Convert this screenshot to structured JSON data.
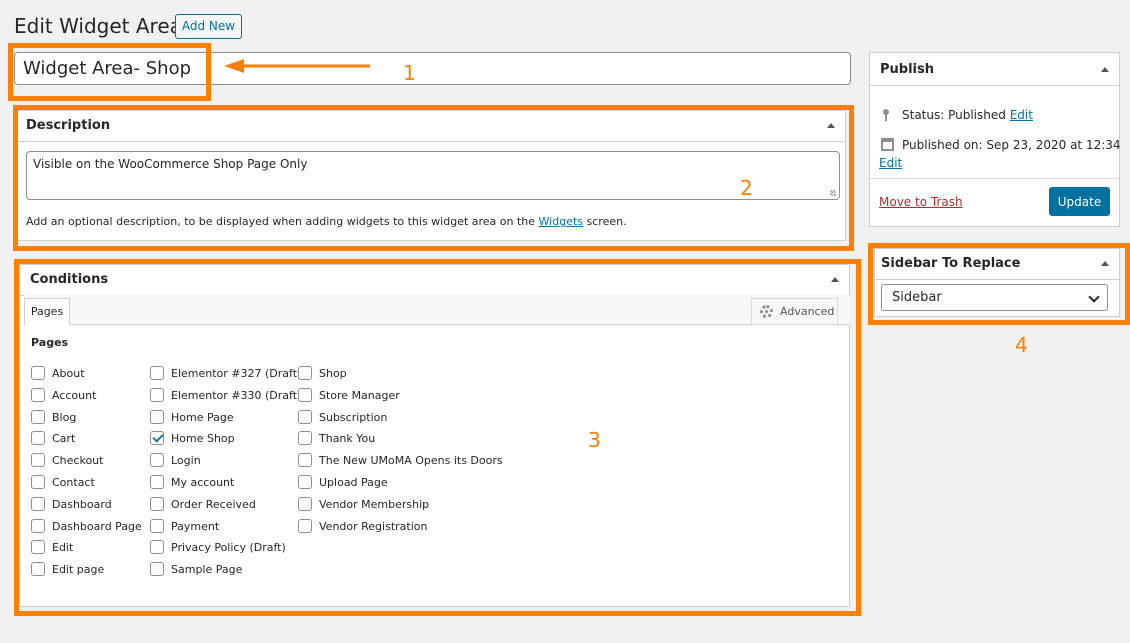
{
  "header": {
    "title": "Edit Widget Area",
    "add_new": "Add New"
  },
  "title_field": {
    "value": "Widget Area- Shop"
  },
  "description_box": {
    "heading": "Description",
    "value": "Visible on the WooCommerce Shop Page Only",
    "help_prefix": "Add an optional description, to be displayed when adding widgets to this widget area on the",
    "help_link": "Widgets",
    "help_suffix": "screen."
  },
  "conditions_box": {
    "heading": "Conditions",
    "tabs": {
      "pages": "Pages",
      "advanced": "Advanced"
    },
    "pages_label": "Pages",
    "columns": [
      [
        {
          "label": "About",
          "checked": false
        },
        {
          "label": "Account",
          "checked": false
        },
        {
          "label": "Blog",
          "checked": false
        },
        {
          "label": "Cart",
          "checked": false
        },
        {
          "label": "Checkout",
          "checked": false
        },
        {
          "label": "Contact",
          "checked": false
        },
        {
          "label": "Dashboard",
          "checked": false
        },
        {
          "label": "Dashboard Page",
          "checked": false
        },
        {
          "label": "Edit",
          "checked": false
        },
        {
          "label": "Edit page",
          "checked": false
        }
      ],
      [
        {
          "label": "Elementor #327 (Draft)",
          "checked": false
        },
        {
          "label": "Elementor #330 (Draft)",
          "checked": false
        },
        {
          "label": "Home Page",
          "checked": false
        },
        {
          "label": "Home Shop",
          "checked": true
        },
        {
          "label": "Login",
          "checked": false
        },
        {
          "label": "My account",
          "checked": false
        },
        {
          "label": "Order Received",
          "checked": false
        },
        {
          "label": "Payment",
          "checked": false
        },
        {
          "label": "Privacy Policy (Draft)",
          "checked": false
        },
        {
          "label": "Sample Page",
          "checked": false
        }
      ],
      [
        {
          "label": "Shop",
          "checked": false
        },
        {
          "label": "Store Manager",
          "checked": false
        },
        {
          "label": "Subscription",
          "checked": false
        },
        {
          "label": "Thank You",
          "checked": false
        },
        {
          "label": "The New UMoMA Opens its Doors",
          "checked": false
        },
        {
          "label": "Upload Page",
          "checked": false
        },
        {
          "label": "Vendor Membership",
          "checked": false
        },
        {
          "label": "Vendor Registration",
          "checked": false
        }
      ]
    ]
  },
  "publish_box": {
    "heading": "Publish",
    "status_label": "Status: Published",
    "status_edit": "Edit",
    "published_label": "Published on: Sep 23, 2020 at 12:34",
    "published_edit": "Edit",
    "trash": "Move to Trash",
    "update": "Update"
  },
  "sidebar_box": {
    "heading": "Sidebar To Replace",
    "selected": "Sidebar"
  },
  "annotations": {
    "n1": "1",
    "n2": "2",
    "n3": "3",
    "n4": "4"
  },
  "colors": {
    "callout": "#ff7f00",
    "primary": "#0071a1",
    "link": "#0073aa",
    "trash": "#b32d2e"
  }
}
